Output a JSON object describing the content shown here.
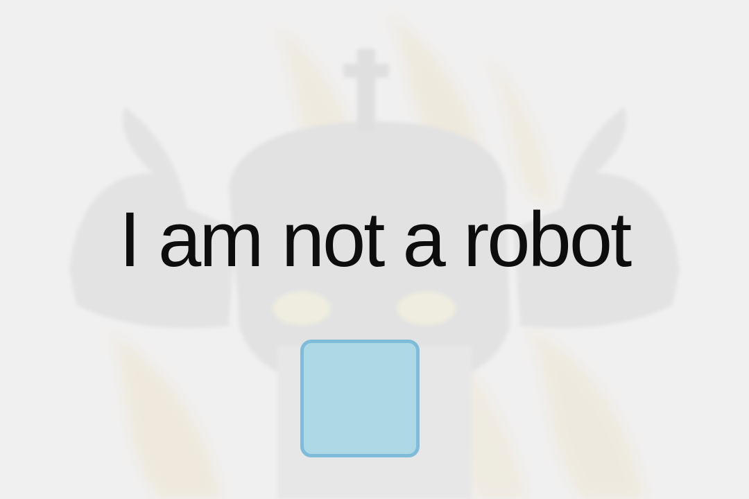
{
  "captcha": {
    "label": "I am not a robot",
    "checkbox_state": "unchecked"
  },
  "colors": {
    "background": "#f0efef",
    "checkbox_fill": "#add8e6",
    "checkbox_border": "#7fbcd9",
    "text": "#0d0d0d"
  },
  "icons": {
    "background": "horned-mascot-with-cross"
  }
}
